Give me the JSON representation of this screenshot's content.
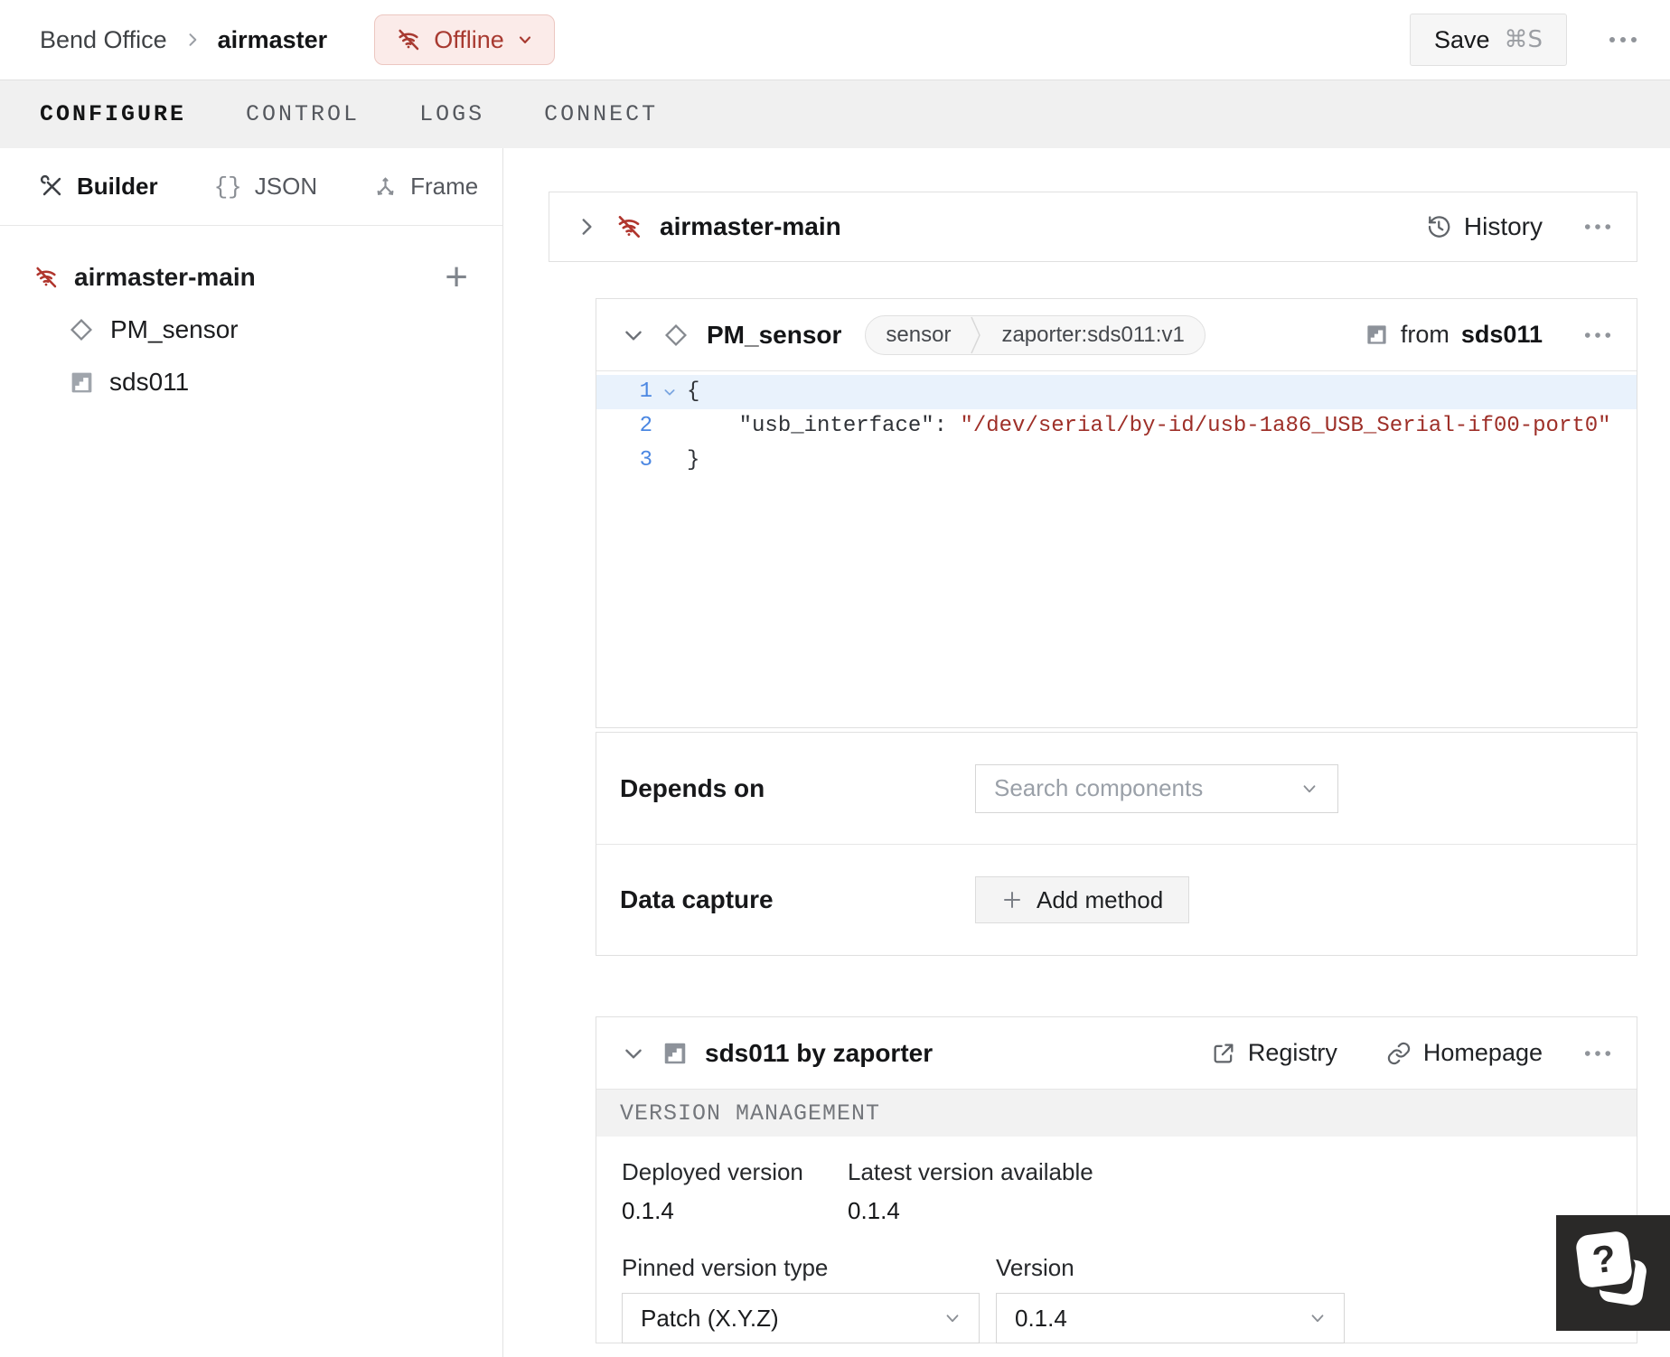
{
  "header": {
    "breadcrumb": {
      "org": "Bend Office",
      "machine": "airmaster"
    },
    "status_badge": {
      "label": "Offline"
    },
    "save_button": {
      "label": "Save",
      "shortcut": "⌘S"
    }
  },
  "tabs": [
    {
      "label": "CONFIGURE"
    },
    {
      "label": "CONTROL"
    },
    {
      "label": "LOGS"
    },
    {
      "label": "CONNECT"
    }
  ],
  "sidebar": {
    "modes": [
      {
        "label": "Builder",
        "icon": "tools-icon"
      },
      {
        "label": "JSON",
        "icon": "braces-icon",
        "glyph": "{}"
      },
      {
        "label": "Frame",
        "icon": "axes-icon"
      }
    ],
    "add_button": "+",
    "tree": [
      {
        "label": "airmaster-main",
        "icon": "wifi-off-icon"
      },
      {
        "label": "PM_sensor",
        "icon": "diamond-icon"
      },
      {
        "label": "sds011",
        "icon": "module-icon"
      }
    ]
  },
  "machine_card": {
    "title": "airmaster-main",
    "history_label": "History"
  },
  "component_card": {
    "title": "PM_sensor",
    "type_badge": "sensor",
    "model_badge": "zaporter:sds011:v1",
    "from_label": "from",
    "from_module": "sds011",
    "code": {
      "lines": [
        {
          "num": "1",
          "plain": "{"
        },
        {
          "num": "2",
          "key": "    \"usb_interface\":",
          "value": " \"/dev/serial/by-id/usb-1a86_USB_Serial-if00-port0\""
        },
        {
          "num": "3",
          "plain": "}"
        }
      ]
    }
  },
  "attributes_panel": {
    "depends_on": {
      "label": "Depends on",
      "placeholder": "Search components"
    },
    "data_capture": {
      "label": "Data capture",
      "add_method_label": "Add method"
    }
  },
  "module_card": {
    "title": "sds011 by zaporter",
    "registry_label": "Registry",
    "homepage_label": "Homepage",
    "section_header": "VERSION MANAGEMENT",
    "deployed_version": {
      "label": "Deployed version",
      "value": "0.1.4"
    },
    "latest_version": {
      "label": "Latest version available",
      "value": "0.1.4"
    },
    "pinned_version_type": {
      "label": "Pinned version type",
      "value": "Patch (X.Y.Z)"
    },
    "version": {
      "label": "Version",
      "value": "0.1.4"
    }
  },
  "help_button": {
    "glyph": "?"
  },
  "colors": {
    "offline_red": "#a83a31",
    "offline_badge_bg": "#fbebe9",
    "code_string_red": "#9e2f28",
    "line_number_blue": "#4b87e2",
    "tabbar_bg": "#f0f0f0"
  }
}
